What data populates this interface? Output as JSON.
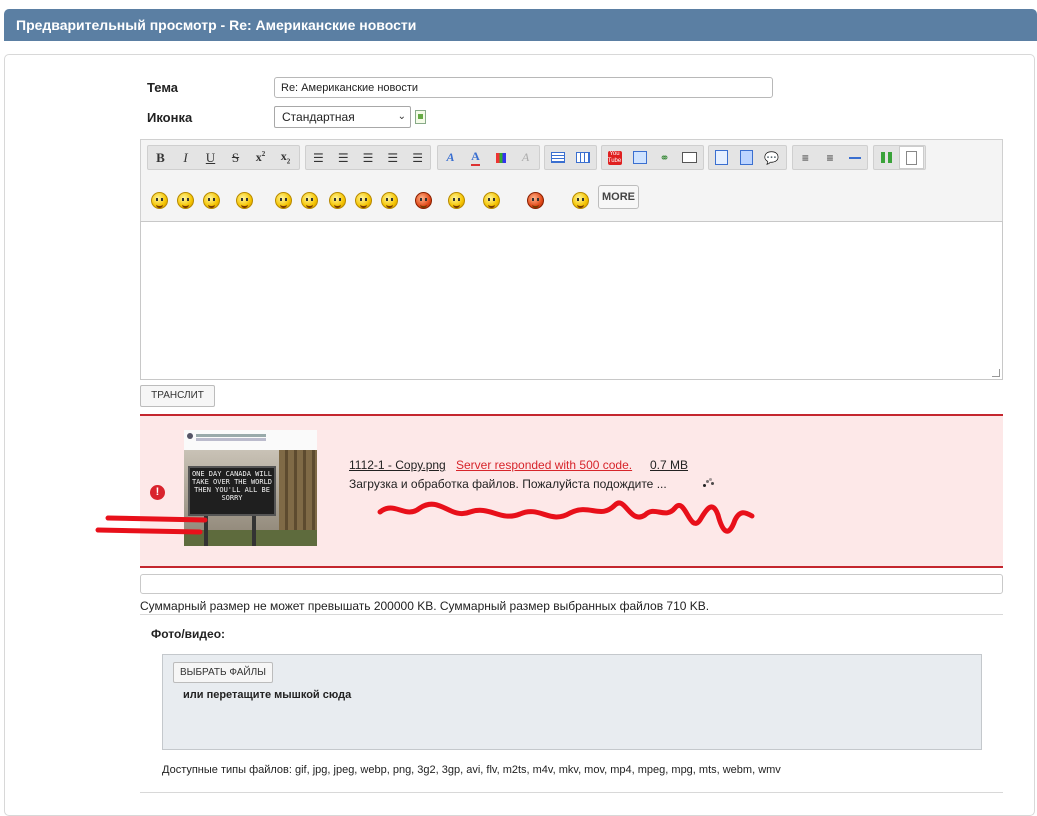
{
  "header": {
    "title": "Предварительный просмотр - Re: Американские новости"
  },
  "form": {
    "subject_label": "Тема",
    "subject_value": "Re: Американские новости",
    "icon_label": "Иконка",
    "icon_selected": "Стандартная"
  },
  "toolbar": {
    "buttons": [
      "bold",
      "italic",
      "underline",
      "strikethrough",
      "superscript",
      "subscript",
      "align-left",
      "align-center",
      "align-right",
      "justify",
      "justify-full",
      "font-face",
      "font-color",
      "bg-color",
      "remove-format",
      "table",
      "table-props",
      "youtube",
      "image",
      "link",
      "email",
      "paste-text",
      "paste-word",
      "quote",
      "unordered-list",
      "ordered-list",
      "horizontal-rule",
      "fullscreen",
      "source"
    ],
    "smilies": [
      "smile",
      "wink",
      "laugh",
      "dance",
      "sad",
      "surprised",
      "cool",
      "tongue",
      "confused",
      "angry",
      "crazy",
      "love",
      "devil",
      "grin"
    ],
    "more_label": "MORE"
  },
  "translit_label": "ТРАНСЛИТ",
  "upload": {
    "filename": "1112-1 - Copy.png",
    "error": "Server responded with 500 code.",
    "size": "0.7 MB",
    "progress_text": "Загрузка и обработка файлов. Пожалуйста подождите ...",
    "warning_icon": "!",
    "thumb_sign": "ONE DAY CANADA WILL TAKE OVER THE WORLD THEN YOU'LL ALL BE SORRY"
  },
  "summary_text": "Суммарный размер не может превышать 200000 KB. Суммарный размер выбранных файлов 710 KB.",
  "photo": {
    "label": "Фото/видео:",
    "choose_files": "ВЫБРАТЬ ФАЙЛЫ",
    "drop_text": "или перетащите мышкой сюда",
    "allowed_types": "Доступные типы файлов: gif, jpg, jpeg, webp, png, 3g2, 3gp, avi, flv, m2ts, m4v, mkv, mov, mp4, mpeg, mpg, mts, webm, wmv"
  },
  "colors": {
    "header_bg": "#5b7fa3",
    "error_red": "#c4262e",
    "error_bg": "#fde8e8",
    "scribble": "#e8101a"
  }
}
